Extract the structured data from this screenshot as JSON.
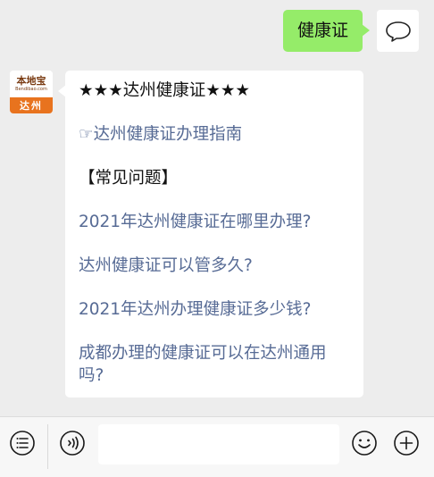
{
  "outgoing": {
    "text": "健康证"
  },
  "bot": {
    "avatar": {
      "logo_main": "本地宝",
      "logo_sub": "Bendibao.com",
      "logo_city": "达州"
    },
    "lines": [
      {
        "text": "★★★达州健康证★★★",
        "link": false
      },
      {
        "text": "☞达州健康证办理指南",
        "link": true
      },
      {
        "text": "【常见问题】",
        "link": false
      },
      {
        "text": "2021年达州健康证在哪里办理?",
        "link": true
      },
      {
        "text": "达州健康证可以管多久?",
        "link": true
      },
      {
        "text": "2021年达州办理健康证多少钱?",
        "link": true
      },
      {
        "text": "成都办理的健康证可以在达州通用吗?",
        "link": true
      }
    ]
  },
  "input_bar": {
    "icons": [
      "menu-list-icon",
      "voice-icon",
      "emoji-icon",
      "plus-icon"
    ],
    "text_value": "",
    "colors": {
      "icon": "#1a1a1a",
      "bar_bg": "#f7f7f7"
    }
  },
  "colors": {
    "bubble_out": "#95ec69",
    "link": "#576b95",
    "chat_bg": "#ededed",
    "logo_orange": "#e8731e"
  }
}
